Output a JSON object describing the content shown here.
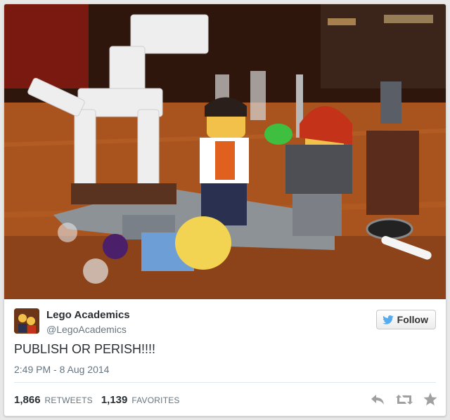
{
  "tweet": {
    "author_name": "Lego Academics",
    "author_handle": "@LegoAcademics",
    "follow_label": "Follow",
    "text": "PUBLISH OR PERISH!!!!",
    "timestamp": "2:49 PM - 8 Aug 2014",
    "retweets_count": "1,866",
    "retweets_label": "RETWEETS",
    "favorites_count": "1,139",
    "favorites_label": "FAVORITES"
  },
  "icons": {
    "follow": "twitter-bird-icon",
    "reply": "reply-icon",
    "retweet": "retweet-icon",
    "favorite": "star-icon"
  },
  "colors": {
    "twitter_blue": "#55acee",
    "text_dark": "#292f33",
    "text_muted": "#66757f",
    "action_gray": "#a0a0a0"
  }
}
